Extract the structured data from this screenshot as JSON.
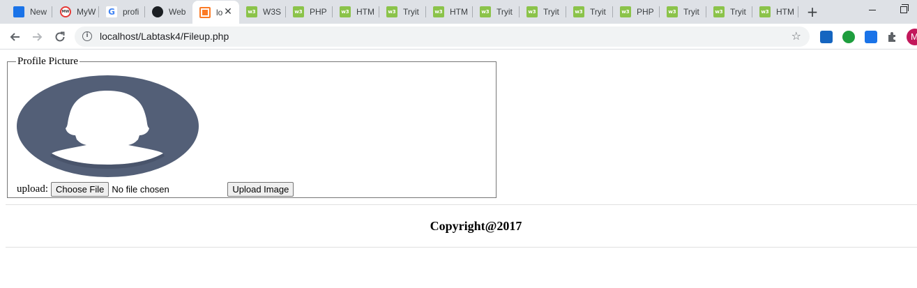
{
  "browser": {
    "tabs": [
      {
        "title": "New",
        "icon": "new-tab-icon",
        "fav": "new",
        "active": false
      },
      {
        "title": "MyW",
        "icon": "mywebsite-icon",
        "fav": "mw",
        "active": false
      },
      {
        "title": "profi",
        "icon": "google-icon",
        "fav": "g",
        "active": false
      },
      {
        "title": "Web",
        "icon": "github-icon",
        "fav": "gh",
        "active": false
      },
      {
        "title": "lo",
        "icon": "xampp-icon",
        "fav": "xa",
        "active": true
      },
      {
        "title": "W3S",
        "icon": "w3schools-icon",
        "fav": "w3",
        "active": false
      },
      {
        "title": "PHP",
        "icon": "w3schools-icon",
        "fav": "w3",
        "active": false
      },
      {
        "title": "HTM",
        "icon": "w3schools-icon",
        "fav": "w3",
        "active": false
      },
      {
        "title": "Tryit",
        "icon": "w3schools-icon",
        "fav": "w3",
        "active": false
      },
      {
        "title": "HTM",
        "icon": "w3schools-icon",
        "fav": "w3",
        "active": false
      },
      {
        "title": "Tryit",
        "icon": "w3schools-icon",
        "fav": "w3",
        "active": false
      },
      {
        "title": "Tryit",
        "icon": "w3schools-icon",
        "fav": "w3",
        "active": false
      },
      {
        "title": "Tryit",
        "icon": "w3schools-icon",
        "fav": "w3",
        "active": false
      },
      {
        "title": "PHP",
        "icon": "w3schools-icon",
        "fav": "w3",
        "active": false
      },
      {
        "title": "Tryit",
        "icon": "w3schools-icon",
        "fav": "w3",
        "active": false
      },
      {
        "title": "Tryit",
        "icon": "w3schools-icon",
        "fav": "w3",
        "active": false
      },
      {
        "title": "HTM",
        "icon": "w3schools-icon",
        "fav": "w3",
        "active": false
      }
    ],
    "url": "localhost/Labtask4/Fileup.php",
    "profile_initial": "M",
    "icons": [
      "back-arrow-icon",
      "forward-arrow-icon",
      "reload-icon",
      "info-icon",
      "bookmark-star-icon",
      "extension-puzzle-icon",
      "plus-icon",
      "close-icon"
    ]
  },
  "form": {
    "legend": "Profile Picture",
    "upload_label": "upload:",
    "choose_file_label": "Choose File",
    "no_file_text": "No file chosen",
    "submit_label": "Upload Image"
  },
  "footer": {
    "copyright": "Copyright@2017"
  },
  "colors": {
    "avatar_bg": "#535f77",
    "avatar_silhouette": "#ffffff",
    "tabstrip_bg": "#dee1e6",
    "omnibox_bg": "#f1f3f4",
    "w3schools_green": "#8bc34a",
    "xampp_orange": "#fb7a24",
    "profile_bg": "#c2185b"
  }
}
